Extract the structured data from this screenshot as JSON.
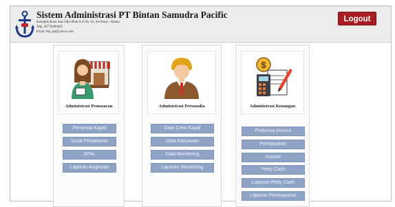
{
  "header": {
    "title": "Sistem Administrasi PT Bintan Samudra Pacific",
    "address_lines": [
      "Komplek Ruko Atas Tahu Blok A.A No. 91, Sei Panas - Batam",
      "Telp. (0778)480402",
      "Email: bsp_tpt@yahoo.com"
    ],
    "logout_label": "Logout",
    "logo_icon": "anchor-icon"
  },
  "modules": [
    {
      "title": "Administrasi Pemasaran",
      "icon": "shop-woman-icon",
      "buttons": [
        "Penyewa Kapal",
        "Surat Penawaran",
        "SPAL",
        "Laporan Angkutan"
      ]
    },
    {
      "title": "Administrasi Personalia",
      "icon": "businessman-icon",
      "buttons": [
        "Data Crew Kapal",
        "Data Karyawan",
        "Data Monitoring",
        "Laporan Monitoring"
      ]
    },
    {
      "title": "Administrasi Keuangan",
      "icon": "finance-calculator-icon",
      "buttons": [
        "Proforma Invoice",
        "Pembayaran",
        "Invoice",
        "Petty Cash",
        "Laporan Petty Cash",
        "Laporan Pembayaran"
      ]
    }
  ],
  "colors": {
    "logout": "#a81c22",
    "menu_button": "#8ea3c6",
    "header_bg": "#ececec"
  }
}
